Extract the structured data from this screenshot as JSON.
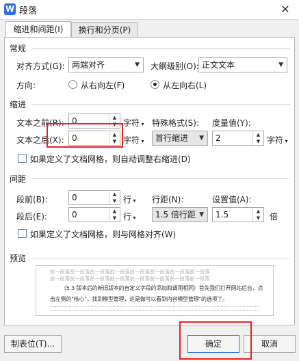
{
  "window": {
    "app_icon": "W",
    "title": "段落",
    "close": "✕"
  },
  "tabs": [
    {
      "label": "缩进和间距(I)",
      "active": true
    },
    {
      "label": "换行和分页(P)",
      "active": false
    }
  ],
  "general": {
    "title": "常规",
    "alignment_label": "对齐方式(G):",
    "alignment_value": "两端对齐",
    "outline_label": "大纲级别(O):",
    "outline_value": "正文文本",
    "direction_label": "方向:",
    "rtl_label": "从右向左(F)",
    "ltr_label": "从左向右(L)",
    "direction_selected": "ltr"
  },
  "indent": {
    "title": "缩进",
    "before_label": "文本之前(R):",
    "before_value": "0",
    "before_unit": "字符",
    "after_label": "文本之后(X):",
    "after_value": "0",
    "after_unit": "字符",
    "special_label": "特殊格式(S):",
    "special_value": "首行缩进",
    "measure_label": "度量值(Y):",
    "measure_value": "2",
    "measure_unit": "字符",
    "grid_checkbox_label": "如果定义了文档网格，则自动调整右缩进(D)"
  },
  "spacing": {
    "title": "间距",
    "before_label": "段前(B):",
    "before_value": "0",
    "before_unit": "行",
    "after_label": "段后(E):",
    "after_value": "0",
    "after_unit": "行",
    "line_label": "行距(N):",
    "line_value": "1.5 倍行距",
    "setting_label": "设置值(A):",
    "setting_value": "1.5",
    "setting_unit": "倍",
    "grid_checkbox_label": "如果定义了文档网格，则与网格对齐(W)"
  },
  "preview": {
    "title": "预览",
    "prev_para": "前一段落前一段落前一段落前一段落前一段落前一段落前一段落前一段落",
    "sample_line_1": "（5.3 版本后的新旧版本的自定义字段的添加和调用相同）首先我们打开网站后台，点",
    "sample_line_2": "击左侧的\"核心\"，找到模型管理，这是做可以看到内容模型管理\"的选项了。"
  },
  "buttons": {
    "tabs": "制表位(T)...",
    "ok": "确定",
    "cancel": "取消"
  }
}
